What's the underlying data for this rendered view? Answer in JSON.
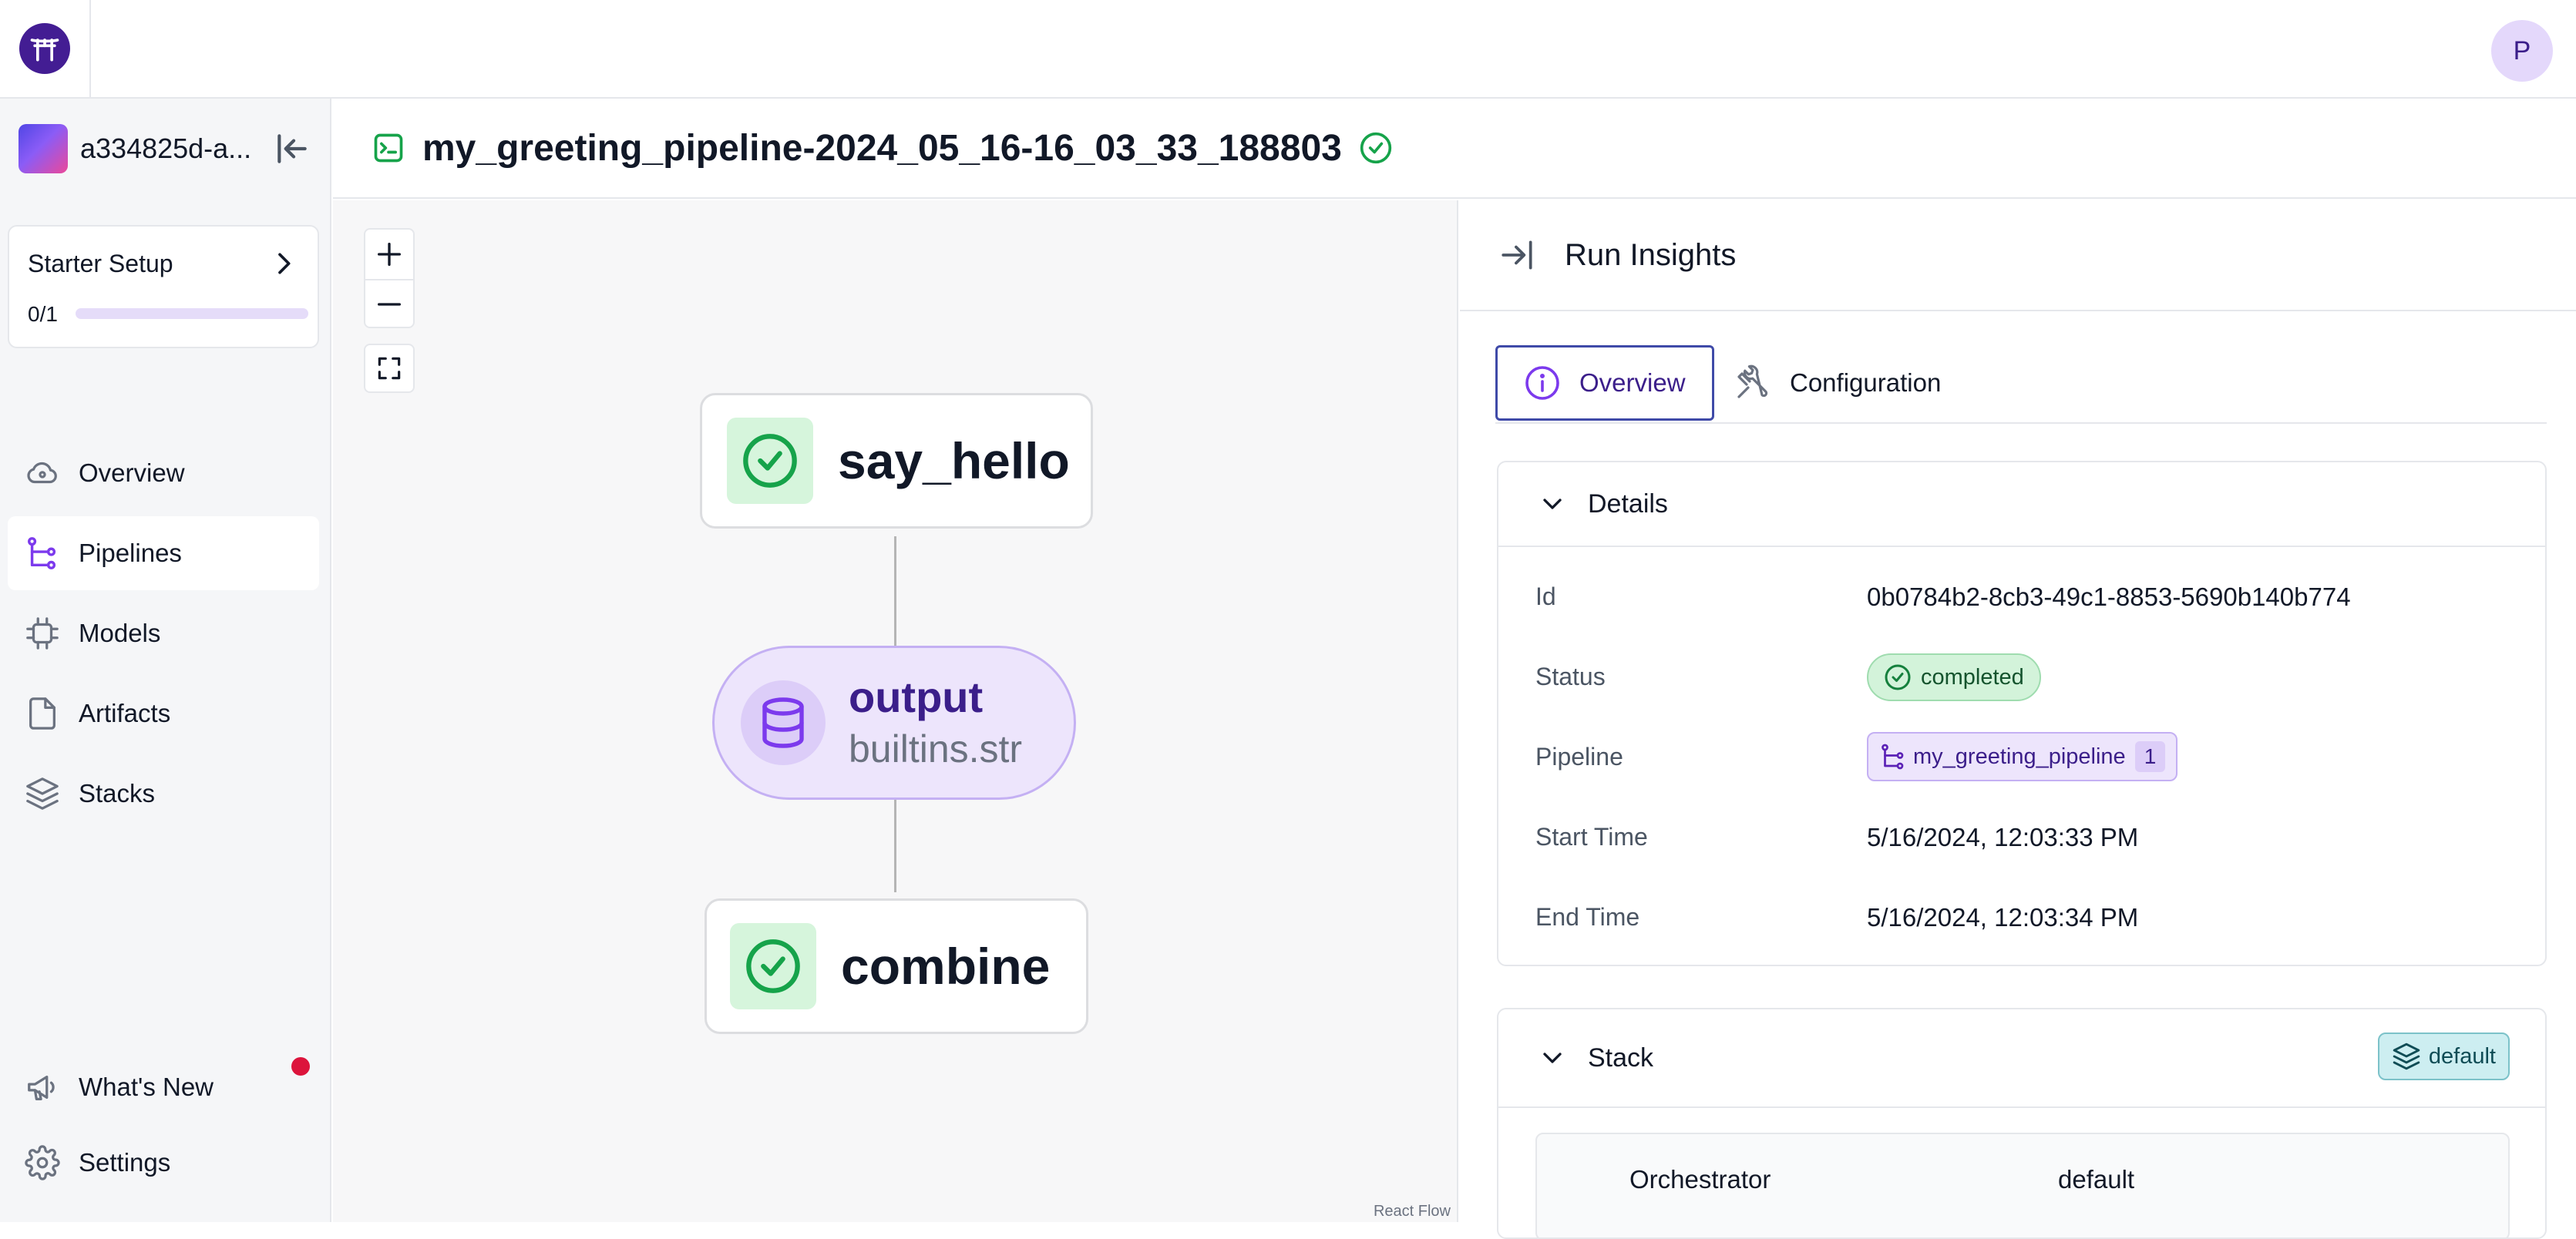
{
  "app": {
    "user_initial": "P"
  },
  "sidebar": {
    "workspace_name": "a334825d-a...",
    "starter_setup": {
      "title": "Starter Setup",
      "count": "0/1",
      "progress": 0
    },
    "items": [
      {
        "label": "Overview"
      },
      {
        "label": "Pipelines",
        "active": true
      },
      {
        "label": "Models"
      },
      {
        "label": "Artifacts"
      },
      {
        "label": "Stacks"
      }
    ],
    "bottom_items": [
      {
        "label": "What's New"
      },
      {
        "label": "Settings"
      }
    ]
  },
  "header": {
    "run_name": "my_greeting_pipeline-2024_05_16-16_03_33_188803"
  },
  "dag": {
    "nodes": [
      {
        "label": "say_hello",
        "kind": "step",
        "status": "completed"
      },
      {
        "label": "output",
        "sublabel": "builtins.str",
        "kind": "artifact"
      },
      {
        "label": "combine",
        "kind": "step",
        "status": "completed"
      }
    ],
    "attribution": "React Flow"
  },
  "insights": {
    "title": "Run Insights",
    "tabs": [
      {
        "label": "Overview",
        "active": true
      },
      {
        "label": "Configuration"
      }
    ],
    "details": {
      "title": "Details",
      "rows": [
        {
          "key": "Id",
          "value": "0b0784b2-8cb3-49c1-8853-5690b140b774"
        },
        {
          "key": "Status",
          "value": "completed"
        },
        {
          "key": "Pipeline",
          "value": "my_greeting_pipeline",
          "badge": "1"
        },
        {
          "key": "Start Time",
          "value": "5/16/2024, 12:03:33 PM"
        },
        {
          "key": "End Time",
          "value": "5/16/2024, 12:03:34 PM"
        }
      ]
    },
    "stack": {
      "title": "Stack",
      "badge": "default",
      "rows": [
        {
          "key": "Orchestrator",
          "value": "default"
        }
      ]
    }
  },
  "colors": {
    "brand": "#431d93",
    "success": "#16a34a",
    "artifact_bg": "#ede5fc",
    "stack_badge": "#cdeef1",
    "notification": "#dc143c"
  }
}
